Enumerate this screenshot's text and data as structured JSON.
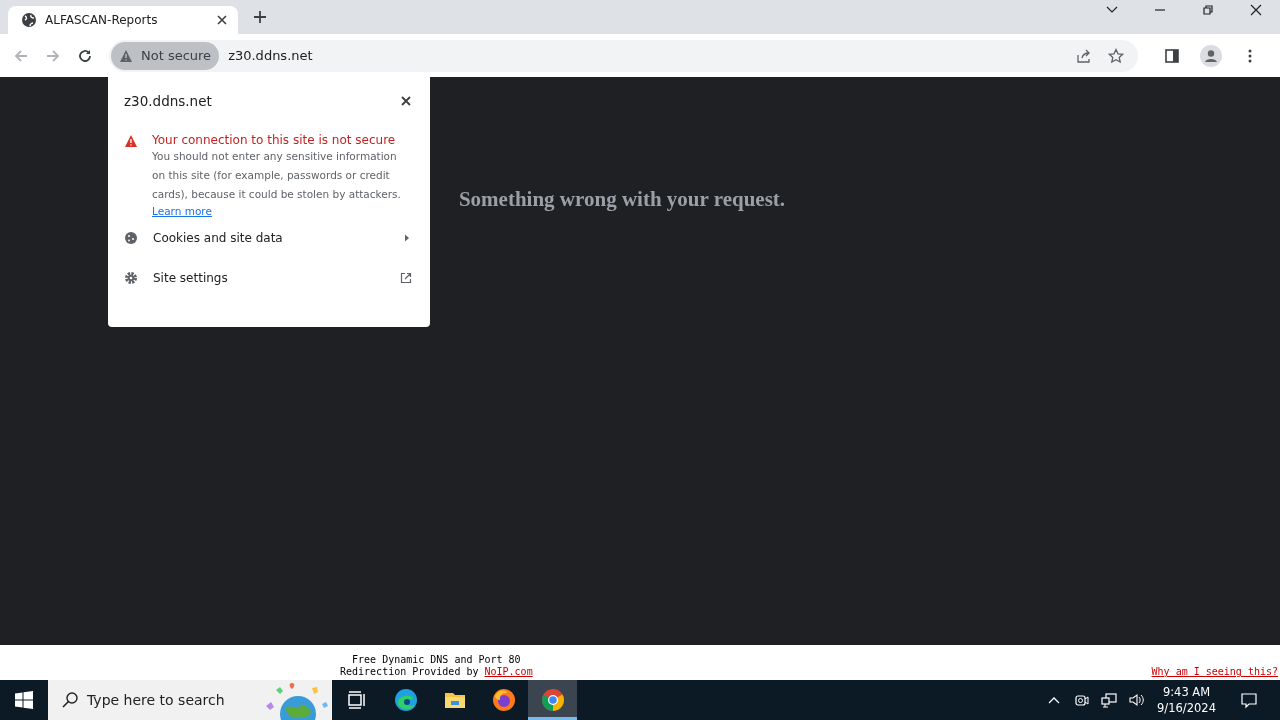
{
  "window": {
    "tab": {
      "title": "ALFASCAN-Reports"
    },
    "address_bar": {
      "security_label": "Not secure",
      "url": "z30.ddns.net"
    }
  },
  "page": {
    "heading": "Something wrong with your request."
  },
  "site_info_popup": {
    "host": "z30.ddns.net",
    "warning_title": "Your connection to this site is not secure",
    "warning_text": "You should not enter any sensitive information on this site (for example, passwords or credit cards), because it could be stolen by attackers.",
    "link": "Learn more",
    "items": [
      {
        "kind": "submenu",
        "label": "Cookies and site data"
      },
      {
        "kind": "external",
        "label": "Site settings"
      }
    ]
  },
  "noip_banner": {
    "line_1": "Free Dynamic DNS and Port 80",
    "line_2": "Redirection Provided by",
    "line_2_link": "NoIP.com",
    "why_link": "Why am I seeing this?"
  },
  "taskbar": {
    "search_placeholder": "Type here to search",
    "apps": [
      {
        "kind": "task-view",
        "selected": false
      },
      {
        "kind": "edge",
        "selected": false
      },
      {
        "kind": "explorer",
        "selected": false
      },
      {
        "kind": "firefox",
        "selected": false
      },
      {
        "kind": "chrome",
        "selected": true
      }
    ],
    "time": "9:43 AM",
    "date": "9/16/2024"
  }
}
